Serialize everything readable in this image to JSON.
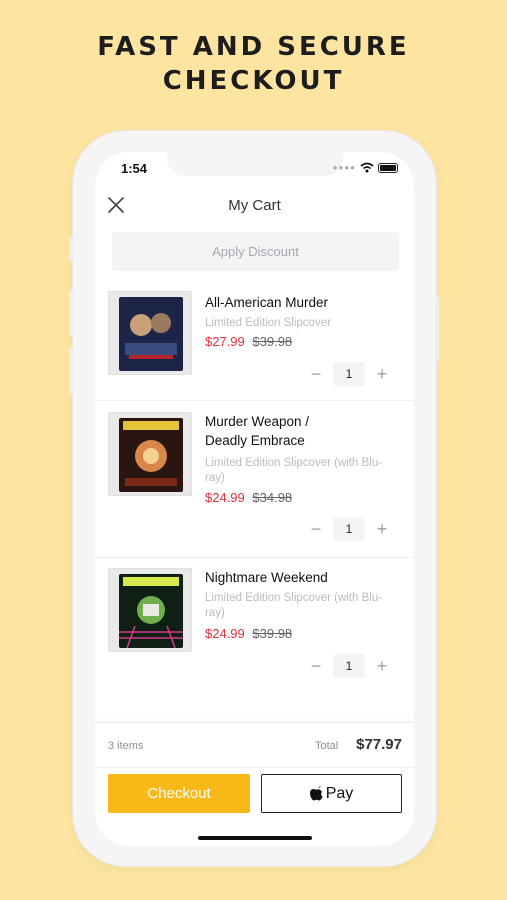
{
  "headline": {
    "line1": "FAST AND SECURE",
    "line2": "CHECKOUT"
  },
  "status_bar": {
    "time": "1:54"
  },
  "header": {
    "title": "My Cart"
  },
  "discount": {
    "label": "Apply Discount"
  },
  "items": [
    {
      "name": "All-American Murder",
      "variant": "Limited Edition Slipcover",
      "sale_price": "$27.99",
      "original_price": "$39.98",
      "quantity": "1"
    },
    {
      "name": "Murder Weapon / Deadly Embrace",
      "variant": "Limited Edition Slipcover (with Blu-ray)",
      "sale_price": "$24.99",
      "original_price": "$34.98",
      "quantity": "1"
    },
    {
      "name": "Nightmare Weekend",
      "variant": "Limited Edition Slipcover (with Blu-ray)",
      "sale_price": "$24.99",
      "original_price": "$39.98",
      "quantity": "1"
    }
  ],
  "summary": {
    "count": "3 items",
    "total_label": "Total",
    "total_value": "$77.97"
  },
  "buttons": {
    "checkout": "Checkout",
    "applepay": "Pay"
  },
  "colors": {
    "background": "#fde5a1",
    "accent": "#f8b818",
    "sale": "#e0313b"
  },
  "icons": [
    "close-icon",
    "wifi-icon",
    "battery-icon",
    "minus-icon",
    "plus-icon",
    "apple-icon"
  ]
}
